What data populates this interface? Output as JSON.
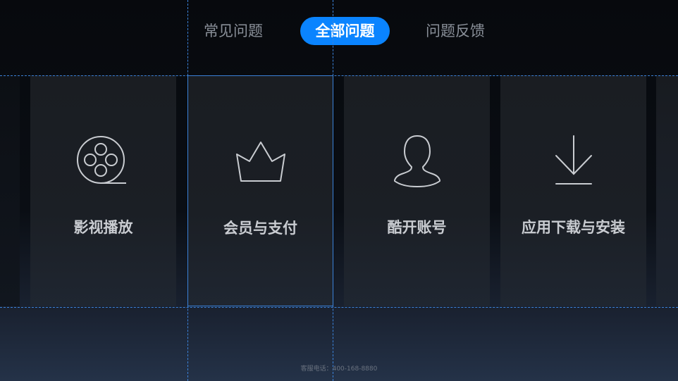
{
  "tabs": [
    {
      "label": "常见问题",
      "active": false
    },
    {
      "label": "全部问题",
      "active": true
    },
    {
      "label": "问题反馈",
      "active": false
    }
  ],
  "categories": [
    {
      "label": "影视播放",
      "icon": "film-reel-icon",
      "focused": false
    },
    {
      "label": "会员与支付",
      "icon": "crown-icon",
      "focused": true
    },
    {
      "label": "酷开账号",
      "icon": "user-icon",
      "focused": false
    },
    {
      "label": "应用下载与安装",
      "icon": "download-icon",
      "focused": false
    }
  ],
  "footer": {
    "hotline": "客服电话：400-168-8880"
  },
  "colors": {
    "accent": "#0a84ff",
    "guide": "#3b82d9",
    "tab_inactive": "#8a9099",
    "card_label": "#c9ccd1"
  }
}
